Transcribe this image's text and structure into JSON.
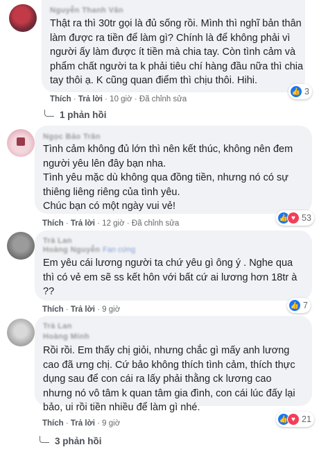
{
  "comments": [
    {
      "name": "Nguyễn Thanh Vân",
      "lines": [
        "Thật ra thì 30tr gọi là đủ sống rồi. Mình thì nghĩ bản thân",
        "làm được ra tiền để làm gì? Chính là để không phải vì",
        "người ấy làm được ít tiền mà chia tay. Còn tình cảm và",
        "phẩm chất người ta k phải tiêu chí hàng đầu nữa thì chia",
        "tay thôi ạ. K cũng quan điểm thì chịu thôi. Hihi."
      ],
      "like": "Thích",
      "reply": "Trả lời",
      "time": "10 giờ",
      "edited": "Đã chỉnh sửa",
      "reaction_count": "3",
      "replies": "1 phản hồi"
    },
    {
      "name": "Ngọc Bảo Trân",
      "lines": [
        "Tình cảm không đủ lớn thì nên kết thúc, không nên đem",
        "người yêu lên đây bạn nha.",
        "Tình yêu mặc dù không qua đồng tiền, nhưng nó có sự",
        "thiêng liêng riêng của tình yêu.",
        "Chúc bạn có một ngày vui vẻ!"
      ],
      "like": "Thích",
      "reply": "Trả lời",
      "time": "12 giờ",
      "edited": "Đã chỉnh sửa",
      "reaction_count": "53"
    },
    {
      "name": "Trà Lan",
      "sub_name": "Hoàng Nguyễn",
      "badge": "Fan cứng",
      "lines": [
        "Em yêu cái lương người ta chứ yêu gì ông ý . Nghe qua",
        "thì có vẻ em sẽ ss kết hôn với bất cứ ai lương hơn 18tr à",
        "??"
      ],
      "like": "Thích",
      "reply": "Trả lời",
      "time": "9 giờ",
      "reaction_count": "7"
    },
    {
      "name": "Trà Lan",
      "sub_name": "Hoàng Minh",
      "lines": [
        "Rồi rồi. Em thấy chị giỏi, nhưng chắc gì mấy anh lương",
        "cao đã ưng chị. Cứ bảo không thích tình cảm, thích thực",
        "dụng sau để con cái ra lấy phải thằng ck lương cao",
        "nhưng nó vô tâm k quan tâm gia đình, con cái lúc đấy lại",
        "bảo, ui rồi tiền nhiều để làm gì nhé."
      ],
      "like": "Thích",
      "reply": "Trả lời",
      "time": "9 giờ",
      "reaction_count": "21",
      "replies": "3 phản hồi"
    }
  ]
}
